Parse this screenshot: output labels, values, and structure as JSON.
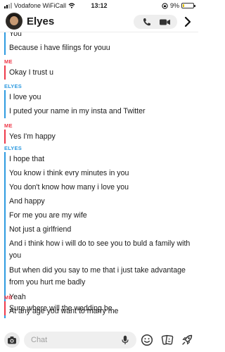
{
  "status_bar": {
    "carrier": "Vodafone WiFiCall",
    "time": "13:12",
    "battery_percent": "9%",
    "battery_level": 0.09,
    "battery_color": "#e0c000"
  },
  "header": {
    "title": "Elyes",
    "icons": [
      "avatar",
      "phone-icon",
      "video-icon",
      "chevron-right-icon"
    ]
  },
  "colors": {
    "me": "#ee3a4a",
    "them": "#2f9be0"
  },
  "messages": [
    {
      "sender": "",
      "side": "them",
      "lines": [
        "You",
        "Because i have filings for youu"
      ]
    },
    {
      "sender": "ME",
      "side": "me",
      "lines": [
        "Okay I trust u"
      ]
    },
    {
      "sender": "ELYES",
      "side": "them",
      "lines": [
        "I love you",
        "I puted your name in my insta and Twitter"
      ]
    },
    {
      "sender": "ME",
      "side": "me",
      "lines": [
        "Yes I'm happy"
      ]
    },
    {
      "sender": "ELYES",
      "side": "them",
      "lines": [
        "I hope that",
        "You know i think evry minutes in you",
        "You don't know how many i love you",
        "And happy",
        "For me you are my wife",
        "Not just a girlfriend",
        "And i think how i will do to see you to buld a family with you",
        "But when did you say to me that i just take advantage from you hurt me badly",
        "Yeah",
        "At any age you want to marry me"
      ]
    },
    {
      "sender": "ME",
      "side": "me",
      "lines": [
        "Sure where will the wedding be"
      ]
    }
  ],
  "composer": {
    "placeholder": "Chat",
    "icons": [
      "camera-icon",
      "mic-icon",
      "smiley-icon",
      "stickers-icon",
      "rocket-icon"
    ]
  }
}
